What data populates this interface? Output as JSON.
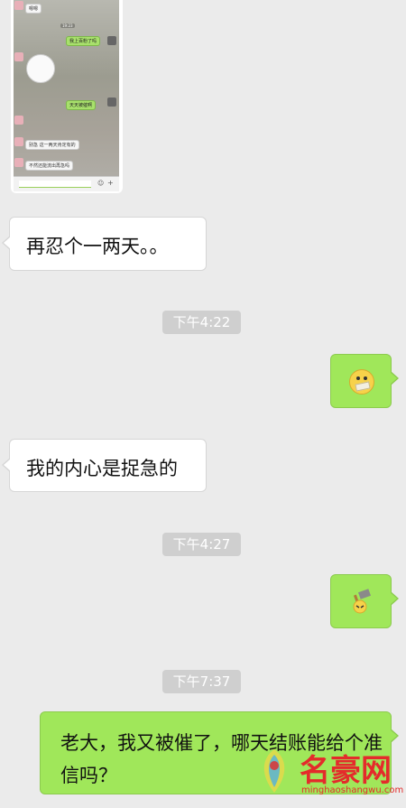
{
  "screenshot_bubble": {
    "messages": [
      {
        "dir": "in",
        "text": "嗯嗯"
      },
      {
        "dir": "time",
        "text": "19:23"
      },
      {
        "dir": "out",
        "text": "我上百粉了吗"
      },
      {
        "dir": "out",
        "text": "天天被催啊"
      },
      {
        "dir": "in",
        "text": "别急 这一两天肯定有的"
      },
      {
        "dir": "in",
        "text": "不然还能流出再急吗"
      }
    ]
  },
  "messages": [
    {
      "type": "in",
      "text": "再忍个一两天。。"
    },
    {
      "type": "time",
      "text": "下午4:22"
    },
    {
      "type": "out-emoji",
      "emoji": "sealed-mouth-emoji"
    },
    {
      "type": "in",
      "text": "我的内心是捉急的"
    },
    {
      "type": "time",
      "text": "下午4:27"
    },
    {
      "type": "out-emoji",
      "emoji": "hammer-emoji"
    },
    {
      "type": "time",
      "text": "下午7:37"
    },
    {
      "type": "out",
      "text": "老大，我又被催了，哪天结账能给个准信吗？"
    }
  ],
  "watermark": {
    "title": "名豪网",
    "subtitle": "minghaoshangwu.com"
  },
  "colors": {
    "background": "#ebebeb",
    "outgoing": "#a0e75a",
    "incoming": "#ffffff",
    "time_pill": "#cfcfcf",
    "watermark": "#e42b2b"
  }
}
